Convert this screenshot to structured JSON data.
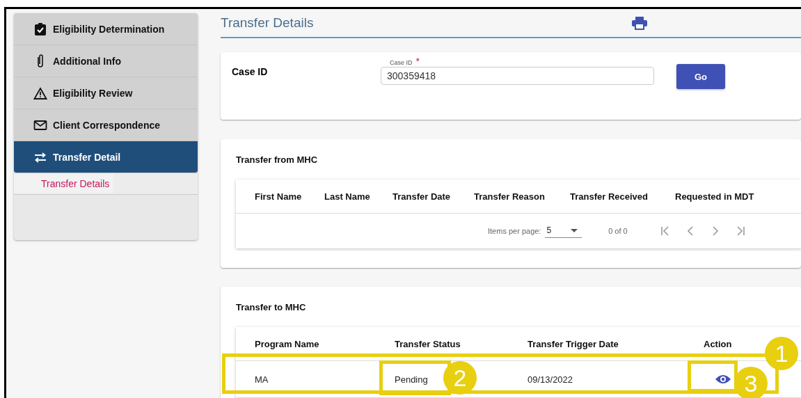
{
  "sidebar": {
    "items": [
      {
        "label": "Eligibility Determination",
        "selected": false
      },
      {
        "label": "Additional Info",
        "selected": false
      },
      {
        "label": "Eligibility Review",
        "selected": false
      },
      {
        "label": "Client Correspondence",
        "selected": false
      },
      {
        "label": "Transfer Detail",
        "selected": true,
        "children": [
          {
            "label": "Transfer Details",
            "selected": true
          }
        ]
      }
    ]
  },
  "page": {
    "title": "Transfer Details"
  },
  "search": {
    "label": "Case ID",
    "field_label": "Case ID",
    "required_mark": "*",
    "value": "300359418",
    "button": "Go"
  },
  "transfer_from": {
    "title": "Transfer from MHC",
    "columns": [
      "First Name",
      "Last Name",
      "Transfer Date",
      "Transfer Reason",
      "Transfer Received",
      "Requested in MDT"
    ],
    "paginator": {
      "items_label": "Items per page:",
      "page_size": "5",
      "range": "0 of 0"
    }
  },
  "transfer_to": {
    "title": "Transfer to MHC",
    "columns": [
      "Program Name",
      "Transfer Status",
      "Transfer Trigger Date",
      "Action"
    ],
    "rows": [
      {
        "program": "MA",
        "status": "Pending",
        "date": "09/13/2022"
      }
    ]
  },
  "callouts": [
    {
      "label": "1"
    },
    {
      "label": "2"
    },
    {
      "label": "3"
    }
  ]
}
